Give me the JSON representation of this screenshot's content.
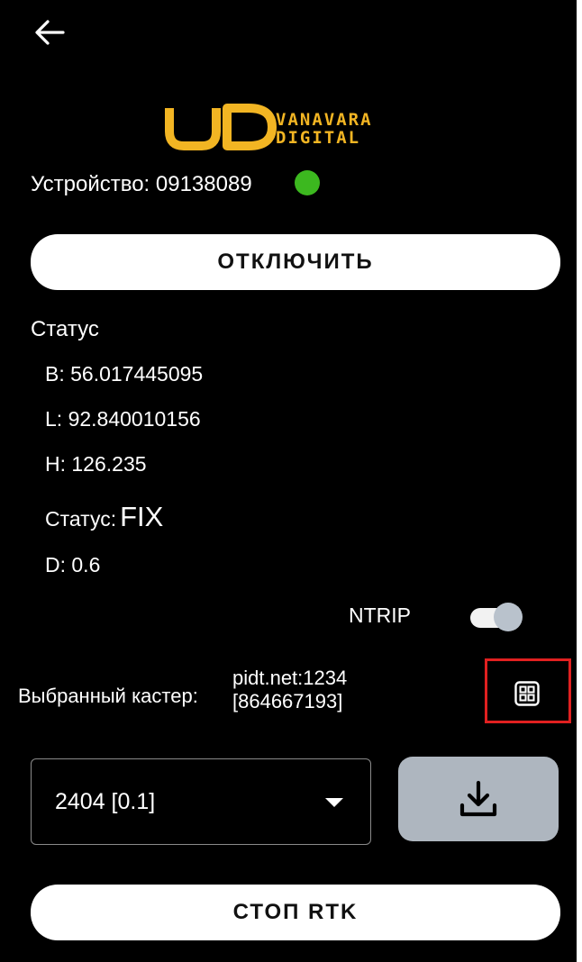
{
  "header": {
    "back_icon": "arrow-left-icon"
  },
  "logo": {
    "line1": "VANAVARA",
    "line2": "DIGITAL",
    "color": "#F2B523"
  },
  "device": {
    "label": "Устройство: 09138089",
    "status_color": "#3CB81F"
  },
  "buttons": {
    "disconnect": "ОТКЛЮЧИТЬ",
    "stop_rtk": "СТОП RTK"
  },
  "status": {
    "title": "Статус",
    "b": "B: 56.017445095",
    "l": "L: 92.840010156",
    "h": "H: 126.235",
    "fix_label": "Статус:",
    "fix_value": "FIX",
    "d": "D: 0.6"
  },
  "ntrip": {
    "label": "NTRIP",
    "enabled": true,
    "track_color": "#f2f2f2",
    "knob_color": "#b9c2cc"
  },
  "caster": {
    "label": "Выбранный кастер:",
    "value_line1": "pidt.net:1234",
    "value_line2": "[864667193]",
    "icon": "grid-icon",
    "highlight_color": "#E02020"
  },
  "mountpoint": {
    "selected": "2404 [0.1]",
    "icon": "caret-down-icon"
  },
  "download": {
    "icon": "download-icon",
    "bg_color": "#AEB6BF"
  }
}
